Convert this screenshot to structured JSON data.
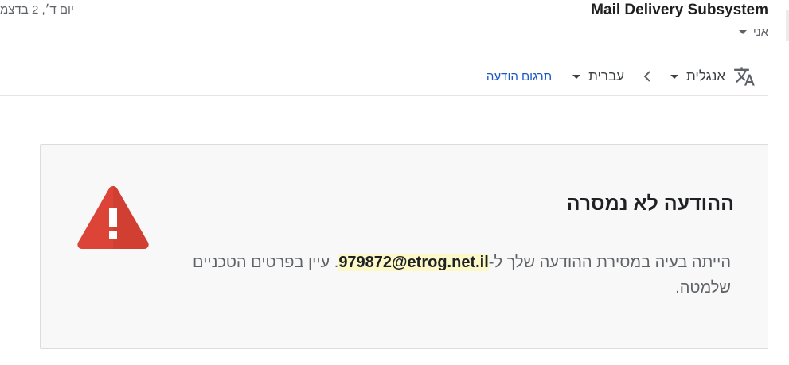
{
  "header": {
    "sender": "Mail Delivery Subsystem",
    "date": "יום ד׳, 2 בדצמ",
    "recipient": "אני"
  },
  "translate_bar": {
    "icon": "translate-icon",
    "source_lang": "אנגלית",
    "target_lang": "עברית",
    "translate_link": "תרגום הודעה"
  },
  "card": {
    "icon": "warning-triangle-icon",
    "title": "ההודעה לא נמסרה",
    "body_prefix": "הייתה בעיה במסירת ההודעה שלך ל-",
    "email": "979872@etrog.net.il",
    "body_suffix": ". עיין בפרטים הטכניים שלמטה."
  },
  "colors": {
    "link": "#1a56c4",
    "warning_red": "#db4437",
    "highlight": "#fcf8c8"
  }
}
